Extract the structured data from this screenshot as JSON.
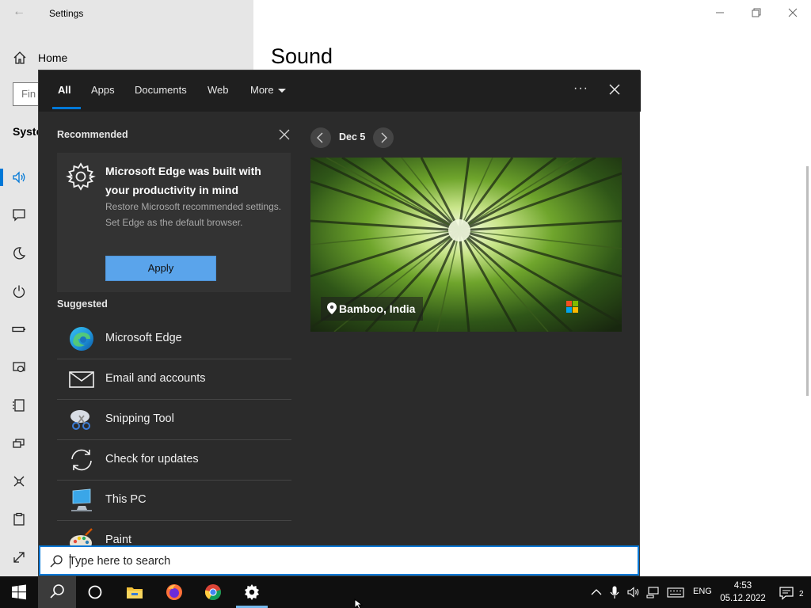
{
  "settings_window": {
    "title": "Settings",
    "home_label": "Home",
    "search_placeholder": "Fin",
    "section_label": "Syste",
    "page_title": "Sound"
  },
  "search_panel": {
    "tabs": [
      {
        "label": "All",
        "active": true
      },
      {
        "label": "Apps",
        "active": false
      },
      {
        "label": "Documents",
        "active": false
      },
      {
        "label": "Web",
        "active": false
      },
      {
        "label": "More",
        "active": false
      }
    ],
    "recommended": {
      "heading": "Recommended",
      "title": "Microsoft Edge was built with your productivity in mind",
      "description": "Restore Microsoft recommended settings. Set Edge as the default browser.",
      "button": "Apply"
    },
    "suggested": {
      "heading": "Suggested",
      "items": [
        {
          "label": "Microsoft Edge",
          "icon": "edge-icon"
        },
        {
          "label": "Email and accounts",
          "icon": "mail-icon"
        },
        {
          "label": "Snipping Tool",
          "icon": "snipping-tool-icon"
        },
        {
          "label": "Check for updates",
          "icon": "refresh-icon"
        },
        {
          "label": "This PC",
          "icon": "computer-icon"
        },
        {
          "label": "Paint",
          "icon": "paint-icon"
        }
      ]
    },
    "highlight": {
      "date": "Dec 5",
      "location": "Bamboo, India",
      "brand": "Microsoft Bing"
    },
    "searchbox_placeholder": "Type here to search"
  },
  "taskbar": {
    "language": "ENG",
    "time": "4:53",
    "date": "05.12.2022",
    "notification_count": "2",
    "apps": [
      "start-icon",
      "search-icon",
      "cortana-icon",
      "file-explorer-icon",
      "firefox-icon",
      "chrome-icon",
      "settings-gear-icon"
    ]
  },
  "colors": {
    "accent": "#0078d7",
    "panel_bg": "#2b2b2b",
    "button_blue": "#5aa4eb",
    "taskbar_bg": "#0f0f0f"
  }
}
